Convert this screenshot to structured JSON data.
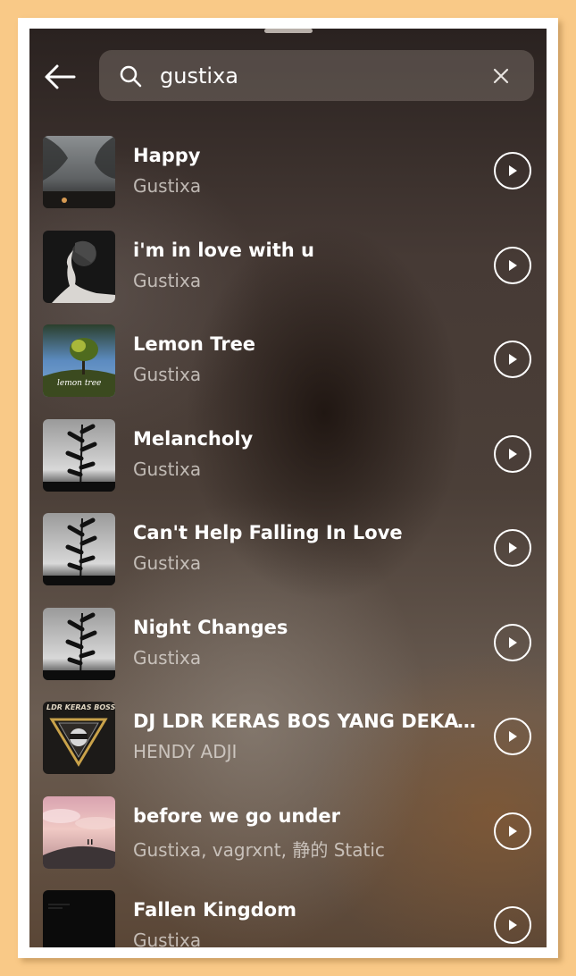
{
  "search": {
    "query": "gustixa"
  },
  "results": [
    {
      "title": "Happy",
      "artist": "Gustixa",
      "thumb": "night-sky-art"
    },
    {
      "title": "i'm in love with u",
      "artist": "Gustixa",
      "thumb": "portrait-profile-art"
    },
    {
      "title": "Lemon Tree",
      "artist": "Gustixa",
      "thumb": "lemon-tree-art",
      "thumb_text": "lemon tree"
    },
    {
      "title": "Melancholy",
      "artist": "Gustixa",
      "thumb": "plant-silhouette-art"
    },
    {
      "title": "Can't Help Falling In Love",
      "artist": "Gustixa",
      "thumb": "plant-silhouette-art"
    },
    {
      "title": "Night Changes",
      "artist": "Gustixa",
      "thumb": "plant-silhouette-art"
    },
    {
      "title": "DJ LDR KERAS BOS YANG DEKAT A...",
      "artist": "HENDY ADJI",
      "thumb": "hendy-logo-art",
      "thumb_text": "LDR KERAS BOSS"
    },
    {
      "title": "before we go under",
      "artist": "Gustixa, vagrxnt, 静的 Static",
      "thumb": "pink-sky-hill-art"
    },
    {
      "title": "Fallen Kingdom",
      "artist": "Gustixa",
      "thumb": "dark-lines-art"
    }
  ],
  "colors": {
    "text": "#ffffff",
    "subtext": "#d8d2cc",
    "search_bg": "#6e6560"
  }
}
